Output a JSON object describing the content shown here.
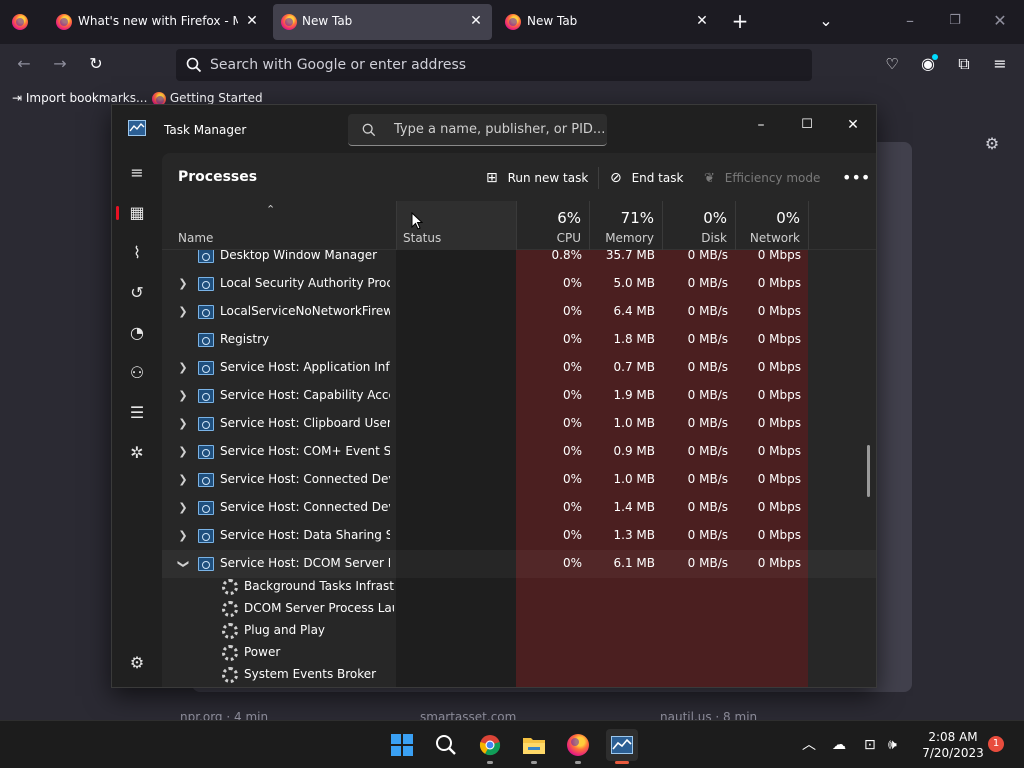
{
  "browser": {
    "tabs": [
      {
        "title": "What's new with Firefox - More"
      },
      {
        "title": "New Tab"
      },
      {
        "title": "New Tab"
      }
    ],
    "address_placeholder": "Search with Google or enter address",
    "bookmarks": [
      "Import bookmarks...",
      "Getting Started"
    ],
    "snippets": [
      "npr.org · 4 min",
      "smartasset.com",
      "nautil.us · 8 min"
    ]
  },
  "task_manager": {
    "title": "Task Manager",
    "search_placeholder": "Type a name, publisher, or PID...",
    "heading": "Processes",
    "commands": {
      "run": "Run new task",
      "end": "End task",
      "efficiency": "Efficiency mode"
    },
    "columns": {
      "name": "Name",
      "status": "Status",
      "cpu": {
        "pct": "6%",
        "label": "CPU"
      },
      "memory": {
        "pct": "71%",
        "label": "Memory"
      },
      "disk": {
        "pct": "0%",
        "label": "Disk"
      },
      "network": {
        "pct": "0%",
        "label": "Network"
      }
    },
    "rows": [
      {
        "name": "Desktop Window Manager",
        "cpu": "0.8%",
        "memory": "35.7 MB",
        "disk": "0 MB/s",
        "network": "0 Mbps"
      },
      {
        "name": "Local Security Authority Proce...",
        "cpu": "0%",
        "memory": "5.0 MB",
        "disk": "0 MB/s",
        "network": "0 Mbps"
      },
      {
        "name": "LocalServiceNoNetworkFirewa...",
        "cpu": "0%",
        "memory": "6.4 MB",
        "disk": "0 MB/s",
        "network": "0 Mbps"
      },
      {
        "name": "Registry",
        "cpu": "0%",
        "memory": "1.8 MB",
        "disk": "0 MB/s",
        "network": "0 Mbps"
      },
      {
        "name": "Service Host: Application Infor...",
        "cpu": "0%",
        "memory": "0.7 MB",
        "disk": "0 MB/s",
        "network": "0 Mbps"
      },
      {
        "name": "Service Host: Capability Acces...",
        "cpu": "0%",
        "memory": "1.9 MB",
        "disk": "0 MB/s",
        "network": "0 Mbps"
      },
      {
        "name": "Service Host: Clipboard User S...",
        "cpu": "0%",
        "memory": "1.0 MB",
        "disk": "0 MB/s",
        "network": "0 Mbps"
      },
      {
        "name": "Service Host: COM+ Event Sys...",
        "cpu": "0%",
        "memory": "0.9 MB",
        "disk": "0 MB/s",
        "network": "0 Mbps"
      },
      {
        "name": "Service Host: Connected Devi...",
        "cpu": "0%",
        "memory": "1.0 MB",
        "disk": "0 MB/s",
        "network": "0 Mbps"
      },
      {
        "name": "Service Host: Connected Devi...",
        "cpu": "0%",
        "memory": "1.4 MB",
        "disk": "0 MB/s",
        "network": "0 Mbps"
      },
      {
        "name": "Service Host: Data Sharing Ser...",
        "cpu": "0%",
        "memory": "1.3 MB",
        "disk": "0 MB/s",
        "network": "0 Mbps"
      },
      {
        "name": "Service Host: DCOM Server Pr...",
        "cpu": "0%",
        "memory": "6.1 MB",
        "disk": "0 MB/s",
        "network": "0 Mbps"
      }
    ],
    "children": [
      "Background Tasks Infrastr...",
      "DCOM Server Process Lau...",
      "Plug and Play",
      "Power",
      "System Events Broker"
    ]
  },
  "taskbar": {
    "time": "2:08 AM",
    "date": "7/20/2023",
    "notifications": "1"
  }
}
